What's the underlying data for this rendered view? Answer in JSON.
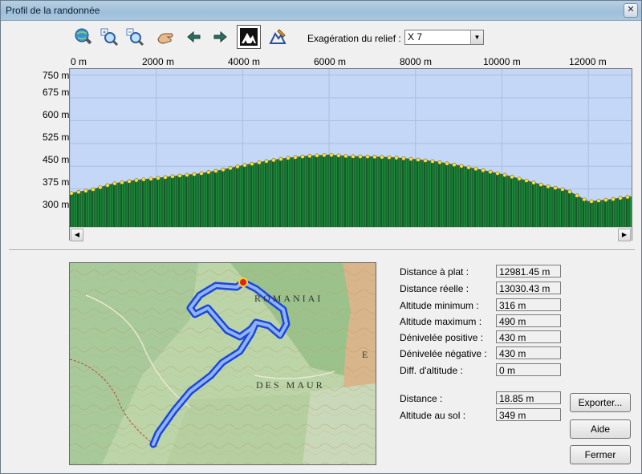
{
  "window": {
    "title": "Profil de la randonnée",
    "close_label": "✕"
  },
  "toolbar": {
    "icons": [
      "zoom-globe-icon",
      "zoom-in-icon",
      "zoom-out-icon",
      "pan-hand-icon",
      "arrow-left-icon",
      "arrow-right-icon",
      "relief-mountain-icon",
      "profile-pen-icon"
    ],
    "relief_label": "Exagération du relief :",
    "relief_value": "X 7"
  },
  "chart_data": {
    "type": "area",
    "x_tick_labels": [
      "0 m",
      "2000 m",
      "4000 m",
      "6000 m",
      "8000 m",
      "10000 m",
      "12000 m"
    ],
    "x_ticks": [
      0,
      2000,
      4000,
      6000,
      8000,
      10000,
      12000
    ],
    "y_tick_labels": [
      "750 m",
      "675 m",
      "600 m",
      "525 m",
      "450 m",
      "375 m",
      "300 m"
    ],
    "y_ticks": [
      750,
      675,
      600,
      525,
      450,
      375,
      300
    ],
    "xlim": [
      0,
      13000
    ],
    "ylim": [
      250,
      770
    ],
    "grid": true,
    "x": [
      0,
      500,
      1000,
      1500,
      2000,
      2500,
      3000,
      3500,
      4000,
      4500,
      5000,
      5500,
      6000,
      6500,
      7000,
      7500,
      8000,
      8500,
      9000,
      9500,
      10000,
      10500,
      11000,
      11500,
      12000,
      12500,
      12981
    ],
    "y": [
      360,
      372,
      392,
      403,
      410,
      418,
      425,
      437,
      452,
      465,
      476,
      483,
      487,
      482,
      481,
      478,
      472,
      464,
      452,
      438,
      423,
      405,
      385,
      371,
      333,
      340,
      350
    ],
    "colors": {
      "fill": "#1e8a3c",
      "line": "#0a0a0a",
      "marker": "#f2e24a",
      "background": "#c4d7f7"
    }
  },
  "stats": [
    {
      "label": "Distance à plat :",
      "value": "12981.45 m"
    },
    {
      "label": "Distance réelle :",
      "value": "13030.43 m"
    },
    {
      "label": "Altitude minimum :",
      "value": "316 m"
    },
    {
      "label": "Altitude maximum :",
      "value": "490 m"
    },
    {
      "label": "Dénivelée positive :",
      "value": "430 m"
    },
    {
      "label": "Dénivelée négative :",
      "value": "430 m"
    },
    {
      "label": "Diff. d'altitude :",
      "value": "0 m"
    }
  ],
  "cursor": [
    {
      "label": "Distance :",
      "value": "18.85 m"
    },
    {
      "label": "Altitude au sol :",
      "value": "349 m"
    }
  ],
  "buttons": {
    "export": "Exporter...",
    "help": "Aide",
    "close": "Fermer"
  },
  "map": {
    "labels": [
      "ROMANIAI",
      "DES MAUR",
      "E"
    ]
  }
}
